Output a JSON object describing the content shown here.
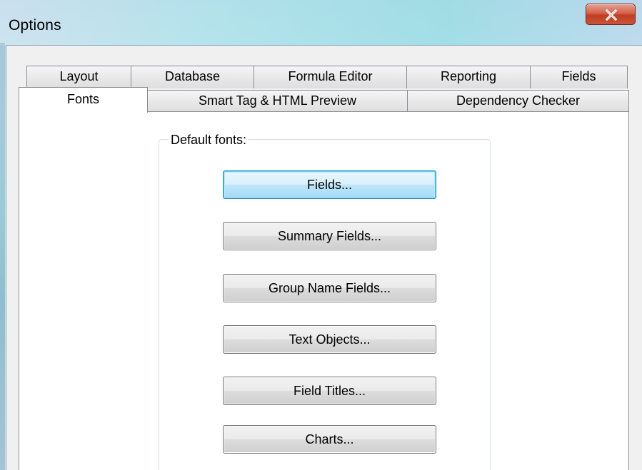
{
  "window": {
    "title": "Options",
    "close_label": "X"
  },
  "tabs": {
    "row_back": [
      "Layout",
      "Database",
      "Formula Editor",
      "Reporting",
      "Fields"
    ],
    "row_front": [
      "Fonts",
      "Smart Tag & HTML Preview",
      "Dependency Checker"
    ],
    "active": "Fonts"
  },
  "fonts_panel": {
    "group_label": "Default fonts:",
    "buttons": [
      "Fields...",
      "Summary Fields...",
      "Group Name Fields...",
      "Text Objects...",
      "Field Titles...",
      "Charts..."
    ],
    "default_button": "Fields..."
  },
  "colors": {
    "title_bar": "#bfe9ec",
    "close_button": "#c23c22",
    "dialog_bg": "#f0f0f0",
    "default_button_border": "#3c7fb1"
  },
  "icons": {
    "close": "close-icon"
  }
}
